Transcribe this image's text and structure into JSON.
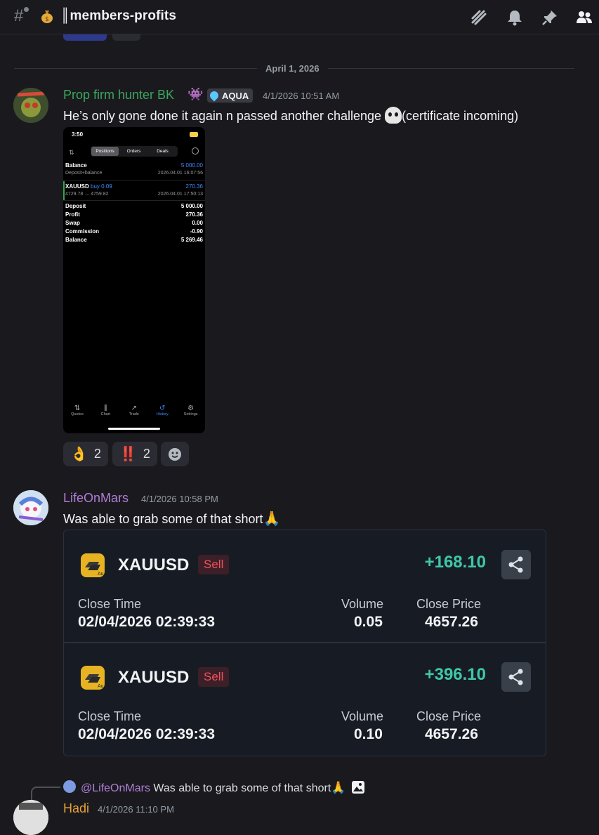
{
  "channel": {
    "name": "║members-profits",
    "icons": [
      "threads-icon",
      "bell-icon",
      "pin-icon",
      "members-icon"
    ]
  },
  "date_divider": "April 1, 2026",
  "message1": {
    "username": "Prop firm hunter BK",
    "tag": "AQUA",
    "timestamp": "4/1/2026 10:51 AM",
    "text": "He’s only gone done it again n passed another challenge",
    "text_suffix": "(certificate incoming)"
  },
  "screenshot": {
    "time": "3:50",
    "tabs": [
      "Positions",
      "Orders",
      "Deals"
    ],
    "balance_label": "Balance",
    "balance_value": "5 000.00",
    "deposit_sub": "Deposit+balance",
    "deposit_date": "2026.04.01 16:07:56",
    "symbol": "XAUUSD",
    "side": "buy 0.09",
    "trade_profit": "270.36",
    "prices": "4729.78 → 4759.82",
    "trade_date": "2026.04.01 17:50:13",
    "summary": [
      {
        "label": "Deposit",
        "value": "5 000.00"
      },
      {
        "label": "Profit",
        "value": "270.36"
      },
      {
        "label": "Swap",
        "value": "0.00"
      },
      {
        "label": "Commission",
        "value": "-0.90"
      },
      {
        "label": "Balance",
        "value": "5 269.46"
      }
    ],
    "nav": [
      "Quotes",
      "Chart",
      "Trade",
      "History",
      "Settings"
    ]
  },
  "reactions": [
    {
      "emoji": "👌",
      "count": "2"
    },
    {
      "emoji": "‼️",
      "count": "2"
    }
  ],
  "message2": {
    "username": "LifeOnMars",
    "timestamp": "4/1/2026 10:58 PM",
    "text": "Was able to grab some of that short"
  },
  "trades": [
    {
      "symbol": "XAUUSD",
      "side": "Sell",
      "profit": "+168.10",
      "close_time_label": "Close Time",
      "close_time": "02/04/2026 02:39:33",
      "volume_label": "Volume",
      "volume": "0.05",
      "close_price_label": "Close Price",
      "close_price": "4657.26"
    },
    {
      "symbol": "XAUUSD",
      "side": "Sell",
      "profit": "+396.10",
      "close_time_label": "Close Time",
      "close_time": "02/04/2026 02:39:33",
      "volume_label": "Volume",
      "volume": "0.10",
      "close_price_label": "Close Price",
      "close_price": "4657.26"
    }
  ],
  "reply": {
    "mention": "@LifeOnMars",
    "text": "Was able to grab some of that short"
  },
  "message3": {
    "username": "Hadi",
    "timestamp": "4/1/2026 11:10 PM"
  },
  "colors": {
    "background": "#1a1a1e",
    "user1": "#3ba55d",
    "user2": "#b07ed6",
    "user3": "#e8a23a",
    "profit": "#3fc8a8",
    "sell": "#f05260"
  }
}
